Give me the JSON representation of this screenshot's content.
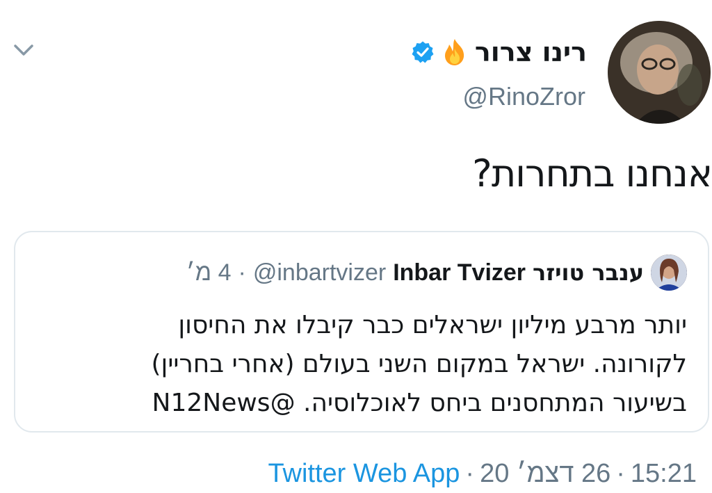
{
  "tweet": {
    "display_name": "רינו צרור",
    "handle": "@RinoZror",
    "text": "אנחנו בתחרות?",
    "icons": {
      "more": "chevron-down-icon",
      "emoji": "fire-emoji-icon",
      "verified": "verified-badge-icon"
    },
    "colors": {
      "verified": "#1da1f2",
      "link": "#1b95e0",
      "secondary": "#657786",
      "border": "#e1e8ed"
    }
  },
  "quoted": {
    "display_name_he": "ענבר טויזר",
    "display_name_en": "Inbar Tvizer",
    "handle": "@inbartvizer",
    "separator": "·",
    "time": "4 מ׳",
    "body_lines": [
      "יותר מרבע מיליון ישראלים כבר קיבלו את החיסון",
      "לקורונה. ישראל במקום השני בעולם (אחרי בחריין)",
      "בשיעור המתחסנים ביחס לאוכלוסיה. @N12News"
    ]
  },
  "footer": {
    "time": "15:21",
    "sep1": "·",
    "date": "26 דצמ׳ 20",
    "sep2": "·",
    "source": "Twitter Web App"
  }
}
